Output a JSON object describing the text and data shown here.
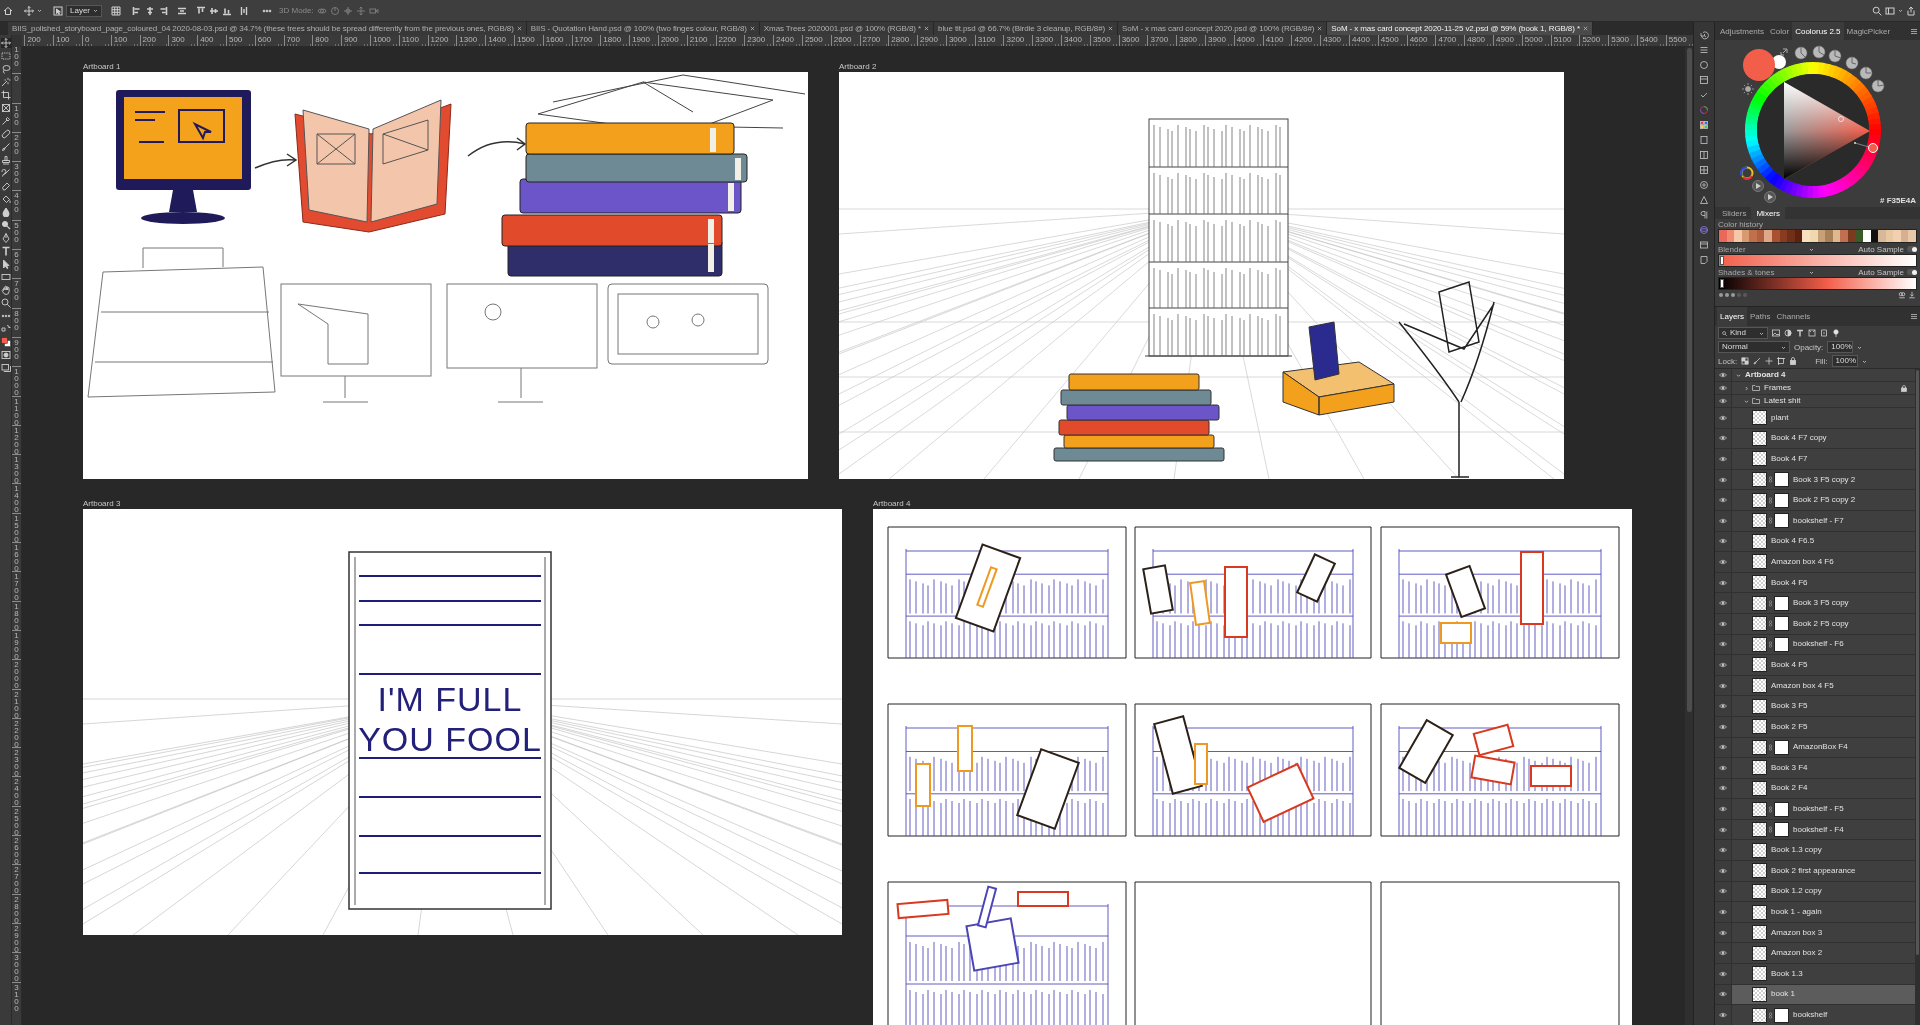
{
  "options_bar": {
    "auto_select": "Layer",
    "three_d": {
      "label": "3D Mode:",
      "disabled": true
    }
  },
  "document_tabs": [
    {
      "title": "BIIS_polished_storyboard_page_coloured_04 2020-08-03.psd @ 34.7% (these trees should be spread differently from the previous ones, RGB/8)",
      "selected": false
    },
    {
      "title": "BIIS - Quotation Hand.psd @ 100% (two finges colour, RGB/8)",
      "selected": false
    },
    {
      "title": "Xmas Trees 2020001.psd @ 100% (RGB/8) *",
      "selected": false
    },
    {
      "title": "blue tit.psd @ 66.7% (Birdie 3 cleanup, RGB/8#)",
      "selected": false
    },
    {
      "title": "SoM - x mas card concept 2020.psd @ 100% (RGB/8#)",
      "selected": false
    },
    {
      "title": "SoM - x mas card concept 2020-11-25 v2.psd @ 59% (book 1, RGB/8) *",
      "selected": true
    }
  ],
  "rulers": {
    "horizontal": [
      "200",
      "100",
      "0",
      "100",
      "200",
      "300",
      "400",
      "500",
      "600",
      "700",
      "800",
      "900",
      "1000",
      "1100",
      "1200",
      "1300",
      "1400",
      "1500",
      "1600",
      "1700",
      "1800",
      "1900",
      "2000",
      "2100",
      "2200",
      "2300",
      "2400",
      "2500",
      "2600",
      "2700",
      "2800",
      "2900",
      "3000",
      "3100",
      "3200",
      "3300",
      "3400",
      "3500",
      "3600",
      "3700",
      "3800",
      "3900",
      "4000",
      "4100",
      "4200",
      "4300",
      "4400",
      "4500",
      "4600",
      "4700",
      "4800",
      "4900",
      "5000",
      "5100",
      "5200",
      "5300",
      "5400",
      "5500"
    ],
    "vertical": [
      "100",
      "0",
      "100",
      "200",
      "300",
      "400",
      "500",
      "600",
      "700",
      "800",
      "900",
      "1000",
      "1100",
      "1200",
      "1300",
      "1400",
      "1500",
      "1600",
      "1700",
      "1800",
      "1900",
      "2000",
      "2100",
      "2200",
      "2300",
      "2400",
      "2500",
      "2600",
      "2700",
      "2800",
      "2900",
      "3000",
      "3100"
    ]
  },
  "toolbar": {
    "tools": [
      {
        "kind": "move",
        "selected": true
      },
      {
        "kind": "marquee",
        "selected": false
      },
      {
        "kind": "lasso",
        "selected": false
      },
      {
        "kind": "wand",
        "selected": false
      },
      {
        "kind": "crop",
        "selected": false
      },
      {
        "kind": "frame",
        "selected": false
      },
      {
        "kind": "eyedropper",
        "selected": false
      },
      {
        "kind": "healing",
        "selected": false
      },
      {
        "kind": "brush",
        "selected": false
      },
      {
        "kind": "stamp",
        "selected": false
      },
      {
        "kind": "history",
        "selected": false
      },
      {
        "kind": "eraser",
        "selected": false
      },
      {
        "kind": "bucket",
        "selected": false
      },
      {
        "kind": "blur",
        "selected": false
      },
      {
        "kind": "dodge",
        "selected": false
      },
      {
        "kind": "pen",
        "selected": false
      },
      {
        "kind": "type",
        "selected": false
      },
      {
        "kind": "path",
        "selected": false
      },
      {
        "kind": "shape",
        "selected": false
      },
      {
        "kind": "hand",
        "selected": false
      },
      {
        "kind": "zoom",
        "selected": false
      },
      {
        "kind": "more",
        "selected": false
      },
      {
        "kind": "swap",
        "selected": false
      },
      {
        "kind": "colors",
        "selected": false
      },
      {
        "kind": "mask",
        "selected": false
      },
      {
        "kind": "screen",
        "selected": false
      }
    ]
  },
  "colors": [
    {
      "kind": "foreground",
      "color": "#f35e4a"
    },
    {
      "kind": "background",
      "color": "#ffffff"
    }
  ],
  "artboards": [
    {
      "label": "Artboard 1",
      "kind": "objects"
    },
    {
      "label": "Artboard 2",
      "kind": "room"
    },
    {
      "label": "Artboard 3",
      "kind": "door",
      "lines": [
        "I'M FULL",
        "YOU FOOL"
      ]
    },
    {
      "label": "Artboard 4",
      "kind": "storyboard",
      "frames": [
        {
          "kind": "sketch"
        },
        {
          "kind": "sketch"
        },
        {
          "kind": "sketch"
        },
        {
          "kind": "sketch"
        },
        {
          "kind": "sketch"
        },
        {
          "kind": "sketch"
        },
        {
          "kind": "sketch"
        },
        {
          "kind": "empty"
        },
        {
          "kind": "empty"
        }
      ]
    }
  ],
  "panel_tabs": [
    {
      "label": "Adjustments",
      "selected": false
    },
    {
      "label": "Color",
      "selected": false
    },
    {
      "label": "Coolorus 2.5",
      "selected": true
    },
    {
      "label": "MagicPicker",
      "selected": false
    }
  ],
  "coolorus": {
    "hex_label": "# F35E4A",
    "subtabs": [
      {
        "label": "Sliders",
        "selected": false
      },
      {
        "label": "Mixers",
        "selected": true
      }
    ],
    "history_label": "Color history",
    "history": [
      {
        "color": "#e8685a"
      },
      {
        "color": "#f08a70"
      },
      {
        "color": "#f4c8a8"
      },
      {
        "color": "#d89a70"
      },
      {
        "color": "#c0704a"
      },
      {
        "color": "#b06040"
      },
      {
        "color": "#e0a888"
      },
      {
        "color": "#a85030"
      },
      {
        "color": "#8a3a20"
      },
      {
        "color": "#703018"
      },
      {
        "color": "#602010"
      },
      {
        "color": "#f8e0c0"
      },
      {
        "color": "#f0d8b0"
      },
      {
        "color": "#c8a078"
      },
      {
        "color": "#a88058"
      },
      {
        "color": "#e0b890"
      },
      {
        "color": "#c07050"
      },
      {
        "color": "#7a3a20"
      },
      {
        "color": "#3a5a2a"
      },
      {
        "color": "#ffffff"
      },
      {
        "color": "#101010"
      },
      {
        "color": "#d8b898"
      },
      {
        "color": "#e8c8a0"
      },
      {
        "color": "#f0d0b0"
      },
      {
        "color": "#d8b090"
      },
      {
        "color": "#e8c8a8"
      }
    ],
    "mixers": [
      {
        "kind": "blender",
        "label": "Blender",
        "auto_label": "Auto Sample",
        "auto": true
      },
      {
        "kind": "shades",
        "label": "Shades & tones",
        "auto_label": "Auto Sample",
        "auto": true
      }
    ],
    "slots": [
      {
        "filled": true
      },
      {
        "filled": true
      },
      {
        "filled": true
      },
      {
        "filled": false
      },
      {
        "filled": false
      }
    ]
  },
  "layers_panel": {
    "tabs": [
      {
        "label": "Layers",
        "selected": true
      },
      {
        "label": "Paths",
        "selected": false
      },
      {
        "label": "Channels",
        "selected": false
      }
    ],
    "filter_label": "Kind",
    "blend_mode": "Normal",
    "opacity_label": "Opacity:",
    "opacity": "100%",
    "lock_label": "Lock:",
    "fill_label": "Fill:",
    "fill": "100%",
    "layers": [
      {
        "name": "Artboard 4",
        "kind": "artboard",
        "visible": true,
        "expanded": true,
        "selected": false,
        "children": [
          {
            "name": "Frames",
            "kind": "group",
            "visible": true,
            "expanded": false,
            "locked": true,
            "selected": false
          },
          {
            "name": "Latest shit",
            "kind": "group",
            "visible": true,
            "expanded": true,
            "locked": false,
            "selected": false,
            "children": [
              {
                "name": "plant",
                "kind": "layer",
                "visible": true,
                "mask": false,
                "selected": false
              },
              {
                "name": "Book 4 F7 copy",
                "kind": "layer",
                "visible": true,
                "mask": false,
                "selected": false
              },
              {
                "name": "Book 4 F7",
                "kind": "layer",
                "visible": true,
                "mask": false,
                "selected": false
              },
              {
                "name": "Book 3 F5 copy 2",
                "kind": "layer",
                "visible": true,
                "mask": true,
                "selected": false
              },
              {
                "name": "Book 2 F5 copy 2",
                "kind": "layer",
                "visible": true,
                "mask": true,
                "selected": false
              },
              {
                "name": "bookshelf - F7",
                "kind": "layer",
                "visible": true,
                "mask": true,
                "selected": false
              },
              {
                "name": "Book 4 F6.5",
                "kind": "layer",
                "visible": true,
                "mask": false,
                "selected": false
              },
              {
                "name": "Amazon box 4 F6",
                "kind": "layer",
                "visible": true,
                "mask": false,
                "selected": false
              },
              {
                "name": "Book 4 F6",
                "kind": "layer",
                "visible": true,
                "mask": false,
                "selected": false
              },
              {
                "name": "Book 3 F5 copy",
                "kind": "layer",
                "visible": true,
                "mask": true,
                "selected": false
              },
              {
                "name": "Book 2 F5 copy",
                "kind": "layer",
                "visible": true,
                "mask": true,
                "selected": false
              },
              {
                "name": "bookshelf - F6",
                "kind": "layer",
                "visible": true,
                "mask": true,
                "selected": false
              },
              {
                "name": "Book 4 F5",
                "kind": "layer",
                "visible": true,
                "mask": false,
                "selected": false
              },
              {
                "name": "Amazon box 4 F5",
                "kind": "layer",
                "visible": true,
                "mask": false,
                "selected": false
              },
              {
                "name": "Book 3 F5",
                "kind": "layer",
                "visible": true,
                "mask": false,
                "selected": false
              },
              {
                "name": "Book 2 F5",
                "kind": "layer",
                "visible": true,
                "mask": false,
                "selected": false
              },
              {
                "name": "AmazonBox F4",
                "kind": "layer",
                "visible": true,
                "mask": true,
                "selected": false
              },
              {
                "name": "Book 3 F4",
                "kind": "layer",
                "visible": true,
                "mask": false,
                "selected": false
              },
              {
                "name": "Book 2 F4",
                "kind": "layer",
                "visible": true,
                "mask": false,
                "selected": false
              },
              {
                "name": "bookshelf - F5",
                "kind": "layer",
                "visible": true,
                "mask": true,
                "selected": false
              },
              {
                "name": "bookshelf - F4",
                "kind": "layer",
                "visible": true,
                "mask": true,
                "selected": false
              },
              {
                "name": "Book 1.3 copy",
                "kind": "layer",
                "visible": true,
                "mask": false,
                "selected": false
              },
              {
                "name": "Book 2 first appearance",
                "kind": "layer",
                "visible": true,
                "mask": false,
                "selected": false
              },
              {
                "name": "Book 1.2 copy",
                "kind": "layer",
                "visible": true,
                "mask": false,
                "selected": false
              },
              {
                "name": "book 1 - again",
                "kind": "layer",
                "visible": true,
                "mask": false,
                "selected": false
              },
              {
                "name": "Amazon box 3",
                "kind": "layer",
                "visible": true,
                "mask": false,
                "selected": false
              },
              {
                "name": "Amazon box 2",
                "kind": "layer",
                "visible": true,
                "mask": false,
                "selected": false
              },
              {
                "name": "Book 1.3",
                "kind": "layer",
                "visible": true,
                "mask": false,
                "selected": false
              },
              {
                "name": "book 1",
                "kind": "layer",
                "visible": true,
                "mask": false,
                "selected": true
              },
              {
                "name": "bookshelf",
                "kind": "layer",
                "visible": true,
                "mask": true,
                "selected": false
              }
            ]
          }
        ]
      }
    ]
  }
}
